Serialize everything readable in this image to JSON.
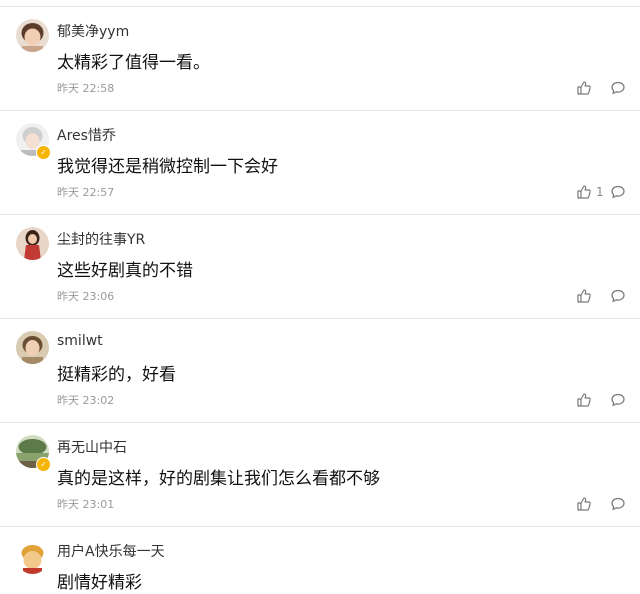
{
  "comments": [
    {
      "username": "郁美净yym",
      "content": "太精彩了值得一看。",
      "time": "昨天 22:58",
      "likes": "",
      "verified": false,
      "avatar_color": "#c9a58c"
    },
    {
      "username": "Ares惜乔",
      "content": "我觉得还是稍微控制一下会好",
      "time": "昨天 22:57",
      "likes": "1",
      "verified": true,
      "avatar_color": "#d8d8d8"
    },
    {
      "username": "尘封的往事YR",
      "content": "这些好剧真的不错",
      "time": "昨天 23:06",
      "likes": "",
      "verified": false,
      "avatar_color": "#c23a34"
    },
    {
      "username": "smilwt",
      "content": "挺精彩的，好看",
      "time": "昨天 23:02",
      "likes": "",
      "verified": false,
      "avatar_color": "#a48a66"
    },
    {
      "username": "再无山中石",
      "content": "真的是这样，好的剧集让我们怎么看都不够",
      "time": "昨天 23:01",
      "likes": "",
      "verified": true,
      "avatar_color": "#5d7a4a"
    },
    {
      "username": "用户A快乐每一天",
      "content": "剧情好精彩",
      "time": "",
      "likes": "",
      "verified": false,
      "avatar_color": "#e2a23a"
    }
  ]
}
